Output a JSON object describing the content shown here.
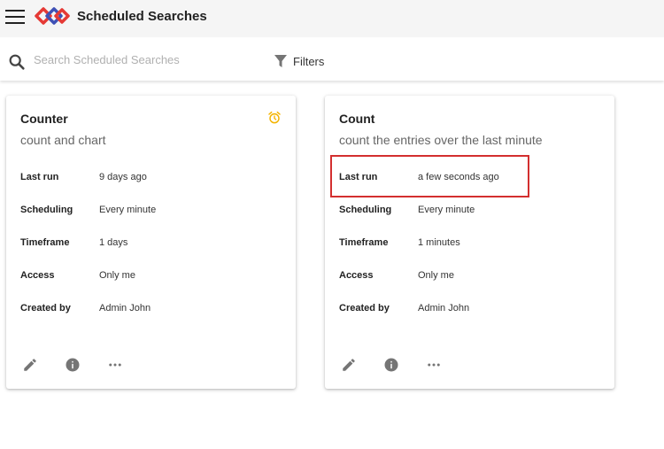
{
  "header": {
    "title": "Scheduled Searches",
    "logo_colors": [
      "#e53935",
      "#3f51b5"
    ]
  },
  "search": {
    "placeholder": "Search Scheduled Searches",
    "value": "",
    "filters_label": "Filters"
  },
  "icons": {
    "menu": "menu-icon",
    "search": "search-icon",
    "filter": "filter-icon",
    "alarm": "alarm-icon",
    "edit": "edit-icon",
    "info": "info-icon",
    "more": "more-horizontal-icon"
  },
  "colors": {
    "alarm": "#f4b400",
    "highlight": "#d32f2f",
    "icon_gray": "#757575"
  },
  "cards": [
    {
      "title": "Counter",
      "subtitle": "count and chart",
      "has_alarm": true,
      "fields": [
        {
          "label": "Last run",
          "value": "9 days ago"
        },
        {
          "label": "Scheduling",
          "value": "Every minute"
        },
        {
          "label": "Timeframe",
          "value": "1 days"
        },
        {
          "label": "Access",
          "value": "Only me"
        },
        {
          "label": "Created by",
          "value": "Admin John"
        }
      ]
    },
    {
      "title": "Count",
      "subtitle": "count the entries over the last minute",
      "has_alarm": false,
      "fields": [
        {
          "label": "Last run",
          "value": "a few seconds ago"
        },
        {
          "label": "Scheduling",
          "value": "Every minute"
        },
        {
          "label": "Timeframe",
          "value": "1 minutes"
        },
        {
          "label": "Access",
          "value": "Only me"
        },
        {
          "label": "Created by",
          "value": "Admin John"
        }
      ]
    }
  ]
}
